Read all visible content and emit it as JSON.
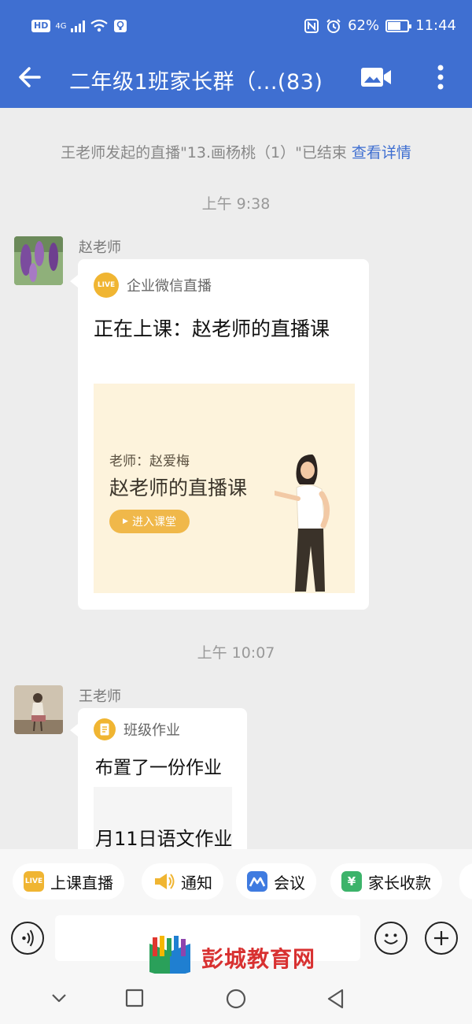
{
  "status_bar": {
    "network_badge": "HD",
    "network_type": "4G",
    "battery": "62%",
    "battery_level": 0.62,
    "time": "11:44"
  },
  "header": {
    "title": "二年级1班家长群（...(83)"
  },
  "colors": {
    "header_bg": "#3f6fd1",
    "link": "#3f6fd1",
    "chat_bg": "#ededed",
    "live_badge": "#f0b532",
    "cover_bg": "#fdf3dc",
    "watermark_text": "#d83131"
  },
  "system_notice": {
    "text": "王老师发起的直播\"13.画杨桃（1）\"已结束",
    "link": "查看详情"
  },
  "messages": [
    {
      "time": "上午 9:38",
      "sender": "赵老师",
      "source_badge": "LIVE",
      "source": "企业微信直播",
      "title": "正在上课：赵老师的直播课",
      "cover": {
        "teacher_label": "老师：赵爱梅",
        "course_name": "赵老师的直播课",
        "enter_button": "进入课堂"
      }
    },
    {
      "time": "上午 10:07",
      "sender": "王老师",
      "source": "班级作业",
      "title": "布置了一份作业",
      "preview": "月11日语文作业"
    }
  ],
  "toolbar": {
    "items": [
      {
        "icon": "live-icon",
        "icon_text": "LIVE",
        "label": "上课直播"
      },
      {
        "icon": "megaphone-icon",
        "label": "通知"
      },
      {
        "icon": "meeting-icon",
        "label": "会议"
      },
      {
        "icon": "yuan-icon",
        "icon_text": "¥",
        "label": "家长收款"
      }
    ]
  },
  "input_bar": {
    "left_icon": "voice-icon",
    "right_icons": [
      "emoji-icon",
      "plus-icon"
    ]
  },
  "watermark": {
    "text": "彭城教育网"
  },
  "system_nav": {
    "buttons": [
      "chevron-down-icon",
      "recents-icon",
      "home-icon",
      "back-triangle-icon"
    ]
  }
}
